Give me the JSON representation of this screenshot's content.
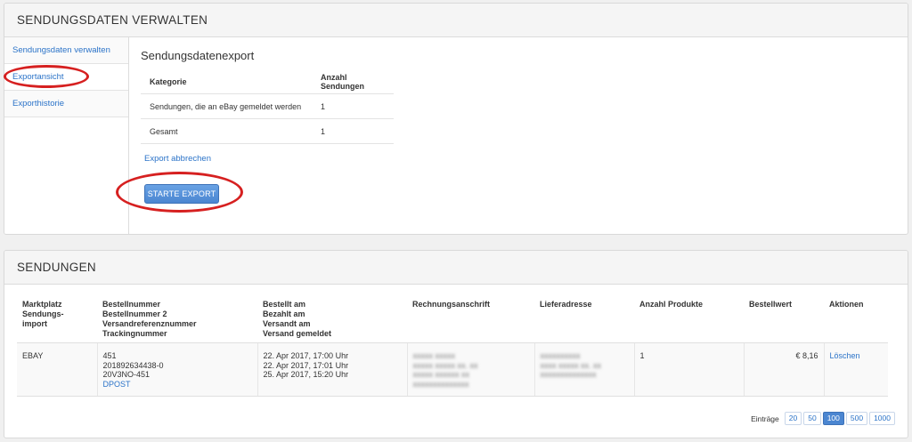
{
  "panel_top": {
    "title": "SENDUNGSDATEN VERWALTEN",
    "sidebar": [
      {
        "label": "Sendungsdaten verwalten"
      },
      {
        "label": "Exportansicht"
      },
      {
        "label": "Exporthistorie"
      }
    ],
    "section_title": "Sendungsdatenexport",
    "table": {
      "headers": [
        "Kategorie",
        "Anzahl Sendungen"
      ],
      "rows": [
        [
          "Sendungen, die an eBay gemeldet werden",
          "1"
        ],
        [
          "Gesamt",
          "1"
        ]
      ]
    },
    "cancel_link": "Export abbrechen",
    "export_button": "STARTE EXPORT"
  },
  "panel_bottom": {
    "title": "SENDUNGEN",
    "headers": {
      "marktplatz": [
        "Marktplatz",
        "Sendungs-",
        "import"
      ],
      "bestellnummer": [
        "Bestellnummer",
        "Bestellnummer 2",
        "Versandreferenznummer",
        "Trackingnummer"
      ],
      "daten": [
        "Bestellt am",
        "Bezahlt am",
        "Versandt am",
        "Versand gemeldet"
      ],
      "rechnung": "Rechnungsanschrift",
      "liefer": "Lieferadresse",
      "anzahl": "Anzahl Produkte",
      "wert": "Bestellwert",
      "aktionen": "Aktionen"
    },
    "row": {
      "marktplatz": "EBAY",
      "bestellnummer": "451",
      "bestellnummer2": "201892634438-0",
      "versandreferenz": "20V3NO-451",
      "tracking": "DPOST",
      "bestellt": "22. Apr 2017, 17:00 Uhr",
      "bezahlt": "22. Apr 2017, 17:01 Uhr",
      "versandt": "25. Apr 2017, 15:20 Uhr",
      "rechnung_lines": [
        "xxxxx xxxxx",
        "xxxxx xxxxx xx. xx",
        "xxxxx xxxxxx xx",
        "xxxxxxxxxxxxxx"
      ],
      "liefer_lines": [
        "xxxxxxxxxx",
        "xxxx xxxxx xx. xx",
        "xxxxxxxxxxxxxx"
      ],
      "anzahl": "1",
      "wert": "€ 8,16",
      "aktion": "Löschen"
    },
    "pager": {
      "label": "Einträge",
      "options": [
        "20",
        "50",
        "100",
        "500",
        "1000"
      ],
      "active": "100"
    }
  },
  "colors": {
    "link": "#2b73c8",
    "button": "#4b86d1",
    "highlight_ring": "#d62020"
  }
}
